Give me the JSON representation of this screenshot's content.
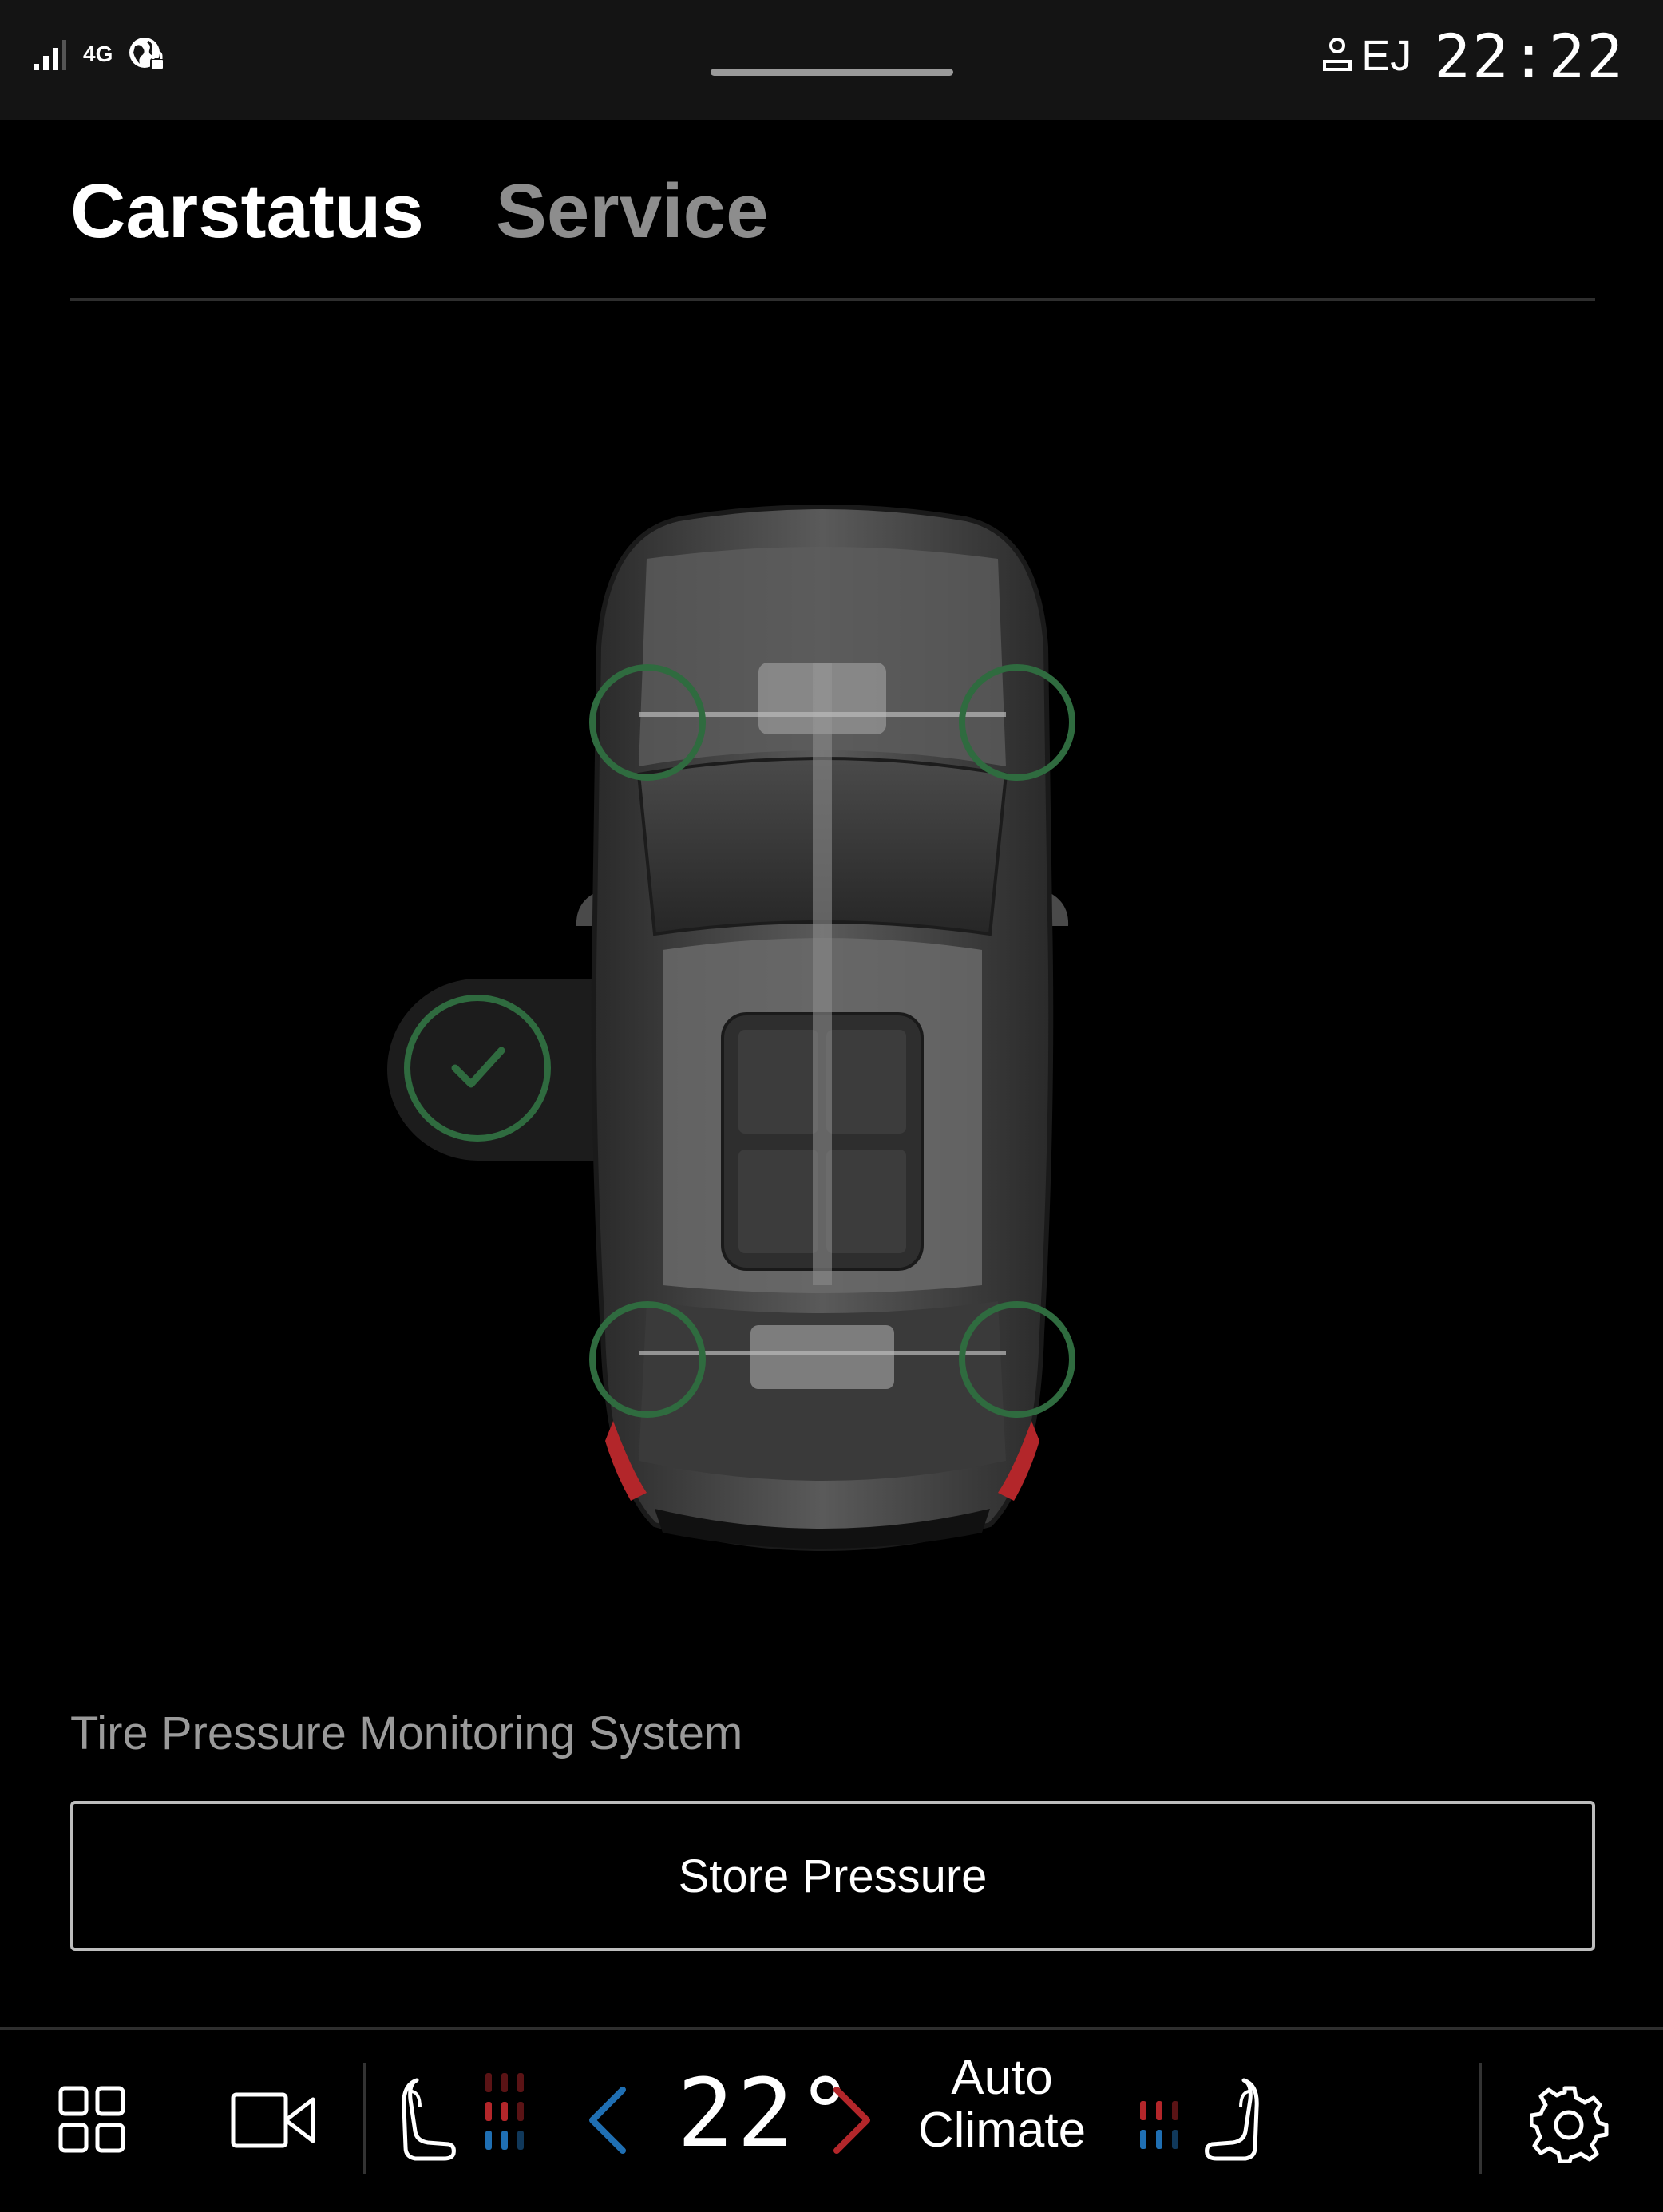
{
  "status_bar": {
    "network": "4G",
    "profile": "EJ",
    "time": "22:22"
  },
  "tabs": [
    {
      "label": "Carstatus",
      "active": true
    },
    {
      "label": "Service",
      "active": false
    }
  ],
  "car": {
    "overall_status": "ok",
    "tires": [
      {
        "position": "front-left",
        "status": "ok"
      },
      {
        "position": "front-right",
        "status": "ok"
      },
      {
        "position": "rear-left",
        "status": "ok"
      },
      {
        "position": "rear-right",
        "status": "ok"
      }
    ],
    "status_color": "#2f6b3f"
  },
  "tpms": {
    "title": "Tire Pressure Monitoring System",
    "button_label": "Store Pressure"
  },
  "climate": {
    "temperature": "22°",
    "mode_line1": "Auto",
    "mode_line2": "Climate",
    "cool_color": "#1f6fb3",
    "heat_color": "#b3262a"
  },
  "icons": {
    "app_grid": "app-grid-icon",
    "camera": "camera-icon",
    "seat_left": "driver-seat-icon",
    "seat_right": "passenger-seat-icon",
    "settings": "gear-icon"
  }
}
